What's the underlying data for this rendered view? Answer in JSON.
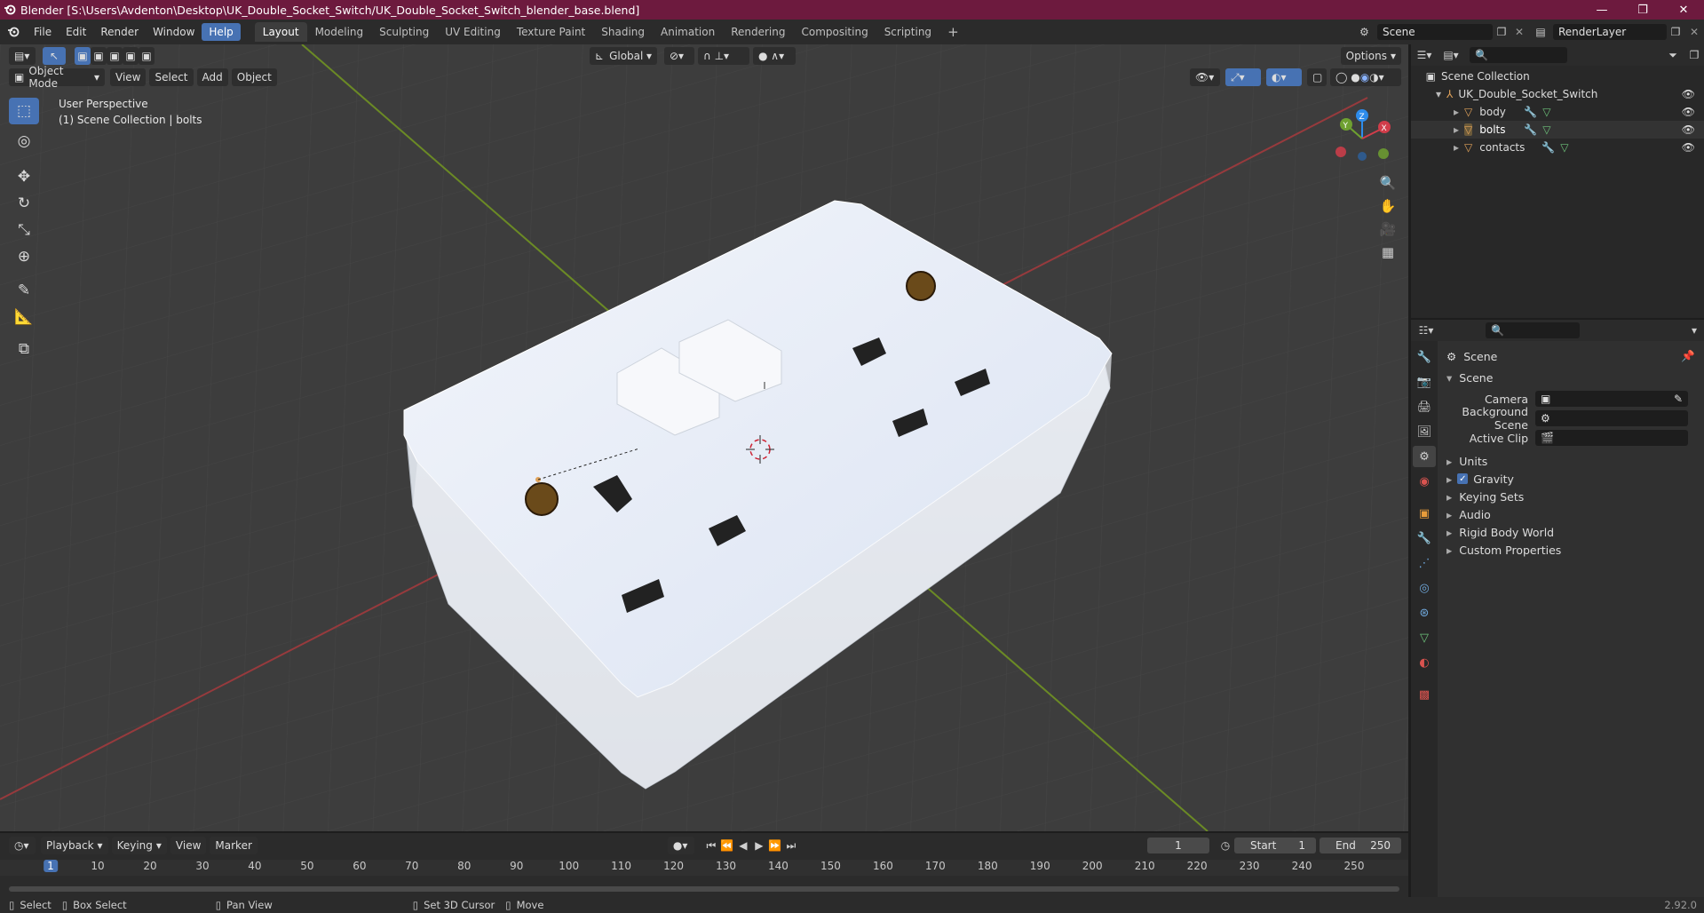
{
  "window": {
    "title": "Blender [S:\\Users\\Avdenton\\Desktop\\UK_Double_Socket_Switch/UK_Double_Socket_Switch_blender_base.blend]",
    "minimize": "—",
    "maximize": "❐",
    "close": "✕"
  },
  "menu": {
    "items": [
      "File",
      "Edit",
      "Render",
      "Window",
      "Help"
    ],
    "workspaces": [
      "Layout",
      "Modeling",
      "Sculpting",
      "UV Editing",
      "Texture Paint",
      "Shading",
      "Animation",
      "Rendering",
      "Compositing",
      "Scripting"
    ],
    "add_tab": "+",
    "scene_name": "Scene",
    "view_layer": "RenderLayer"
  },
  "viewport": {
    "mode": "Object Mode",
    "menus": [
      "View",
      "Select",
      "Add",
      "Object"
    ],
    "orientation": "Global",
    "options_label": "Options",
    "overlay_title": "User Perspective",
    "overlay_subtitle": "(1) Scene Collection | bolts",
    "gizmo": {
      "x": "X",
      "y": "Y",
      "z": "Z"
    }
  },
  "outliner": {
    "root": "Scene Collection",
    "collection": "UK_Double_Socket_Switch",
    "objects": [
      "body",
      "bolts",
      "contacts"
    ]
  },
  "properties": {
    "header": "Scene",
    "section": "Scene",
    "fields": [
      {
        "label": "Camera",
        "value": ""
      },
      {
        "label": "Background Scene",
        "value": ""
      },
      {
        "label": "Active Clip",
        "value": ""
      }
    ],
    "panels": [
      "Units",
      "Gravity",
      "Keying Sets",
      "Audio",
      "Rigid Body World",
      "Custom Properties"
    ],
    "gravity_checked": true
  },
  "timeline": {
    "menus": [
      "Playback",
      "Keying",
      "View",
      "Marker"
    ],
    "current_frame": "1",
    "start_label": "Start",
    "start_value": "1",
    "end_label": "End",
    "end_value": "250",
    "ticks": [
      "1",
      "10",
      "20",
      "30",
      "40",
      "50",
      "60",
      "70",
      "80",
      "90",
      "100",
      "110",
      "120",
      "130",
      "140",
      "150",
      "160",
      "170",
      "180",
      "190",
      "200",
      "210",
      "220",
      "230",
      "240",
      "250"
    ]
  },
  "status": {
    "select": "Select",
    "box_select": "Box Select",
    "pan_view": "Pan View",
    "set_cursor": "Set 3D Cursor",
    "move": "Move",
    "version": "2.92.0"
  }
}
